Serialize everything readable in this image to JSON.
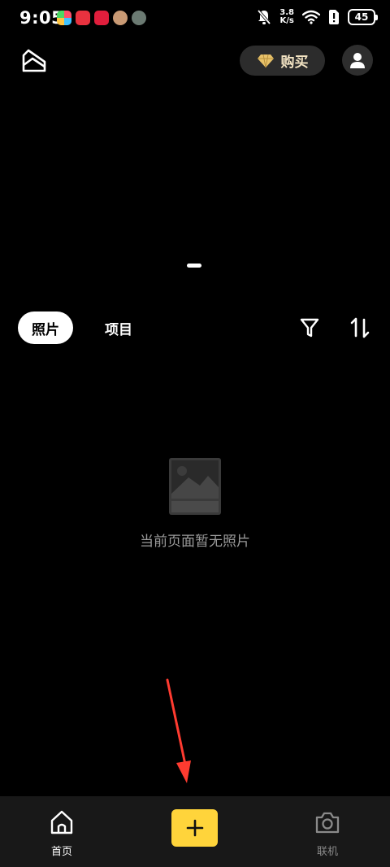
{
  "status_bar": {
    "time": "9:05",
    "net_speed_value": "3.8",
    "net_speed_unit": "K/s",
    "battery": "45",
    "app_icons": [
      "photos-app-icon",
      "red-app-icon",
      "xiaohongshu-icon",
      "avatar-app-icon",
      "avatar-app-icon-2"
    ]
  },
  "header": {
    "buy_label": "购买",
    "gem_color": "#e8c26a"
  },
  "tabs": [
    {
      "label": "照片",
      "active": true
    },
    {
      "label": "项目",
      "active": false
    }
  ],
  "empty_state": {
    "message": "当前页面暂无照片"
  },
  "bottom_nav": {
    "home_label": "首页",
    "connect_label": "联机",
    "add_color": "#ffd43b"
  },
  "annotation_arrow_color": "#ff3b30"
}
